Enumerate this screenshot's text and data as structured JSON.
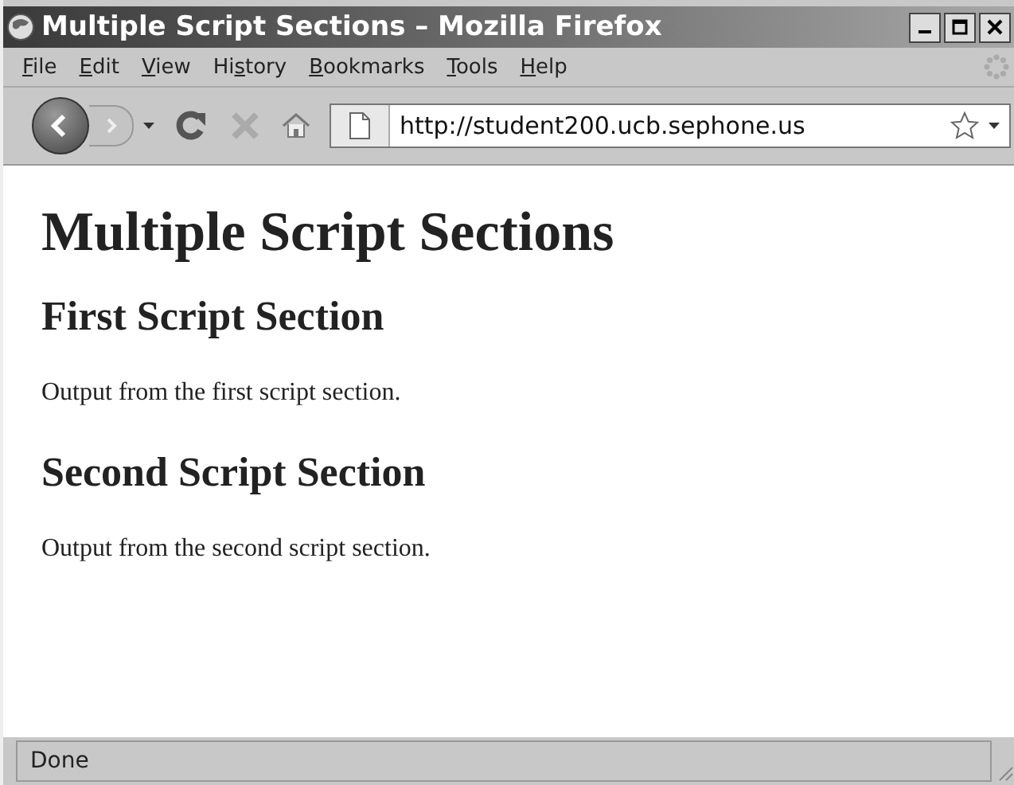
{
  "window": {
    "title": "Multiple Script Sections – Mozilla Firefox"
  },
  "menu": [
    {
      "accesskey": "F",
      "after": "ile"
    },
    {
      "accesskey": "E",
      "after": "dit"
    },
    {
      "accesskey": "V",
      "after": "iew"
    },
    {
      "before": "Hi",
      "accesskey": "s",
      "after": "tory"
    },
    {
      "accesskey": "B",
      "after": "ookmarks"
    },
    {
      "accesskey": "T",
      "after": "ools"
    },
    {
      "accesskey": "H",
      "after": "elp"
    }
  ],
  "toolbar": {
    "back_disabled": false,
    "forward_disabled": true,
    "stop_disabled": true,
    "url": "http://student200.ucb.sephone.us"
  },
  "page": [
    {
      "kind": "h1",
      "text": "Multiple Script Sections"
    },
    {
      "kind": "h2",
      "text": "First Script Section"
    },
    {
      "kind": "p",
      "text": "Output from the first script section."
    },
    {
      "kind": "h2",
      "text": "Second Script Section"
    },
    {
      "kind": "p",
      "text": "Output from the second script section."
    }
  ],
  "status_bar": "Done"
}
